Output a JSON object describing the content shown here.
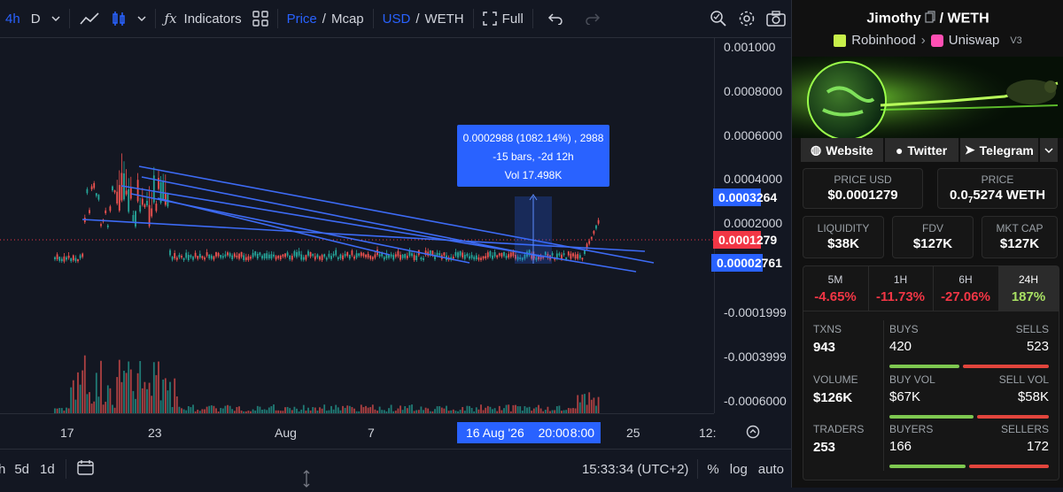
{
  "toolbar": {
    "interval": "4h",
    "day": "D",
    "indicators": "Indicators",
    "price": "Price",
    "mcap": "Mcap",
    "usd": "USD",
    "weth": "WETH",
    "full": "Full"
  },
  "price_axis": {
    "ticks": [
      "0.001000",
      "0.0008000",
      "0.0006000",
      "0.0004000",
      "0.0002000",
      "-0.0001999",
      "-0.0003999",
      "-0.0006000"
    ],
    "label_high": "0.0003264",
    "label_current": "0.0001279",
    "label_low": "0.00002761"
  },
  "time_axis": {
    "ticks": [
      "17",
      "23",
      "Aug",
      "7",
      "25",
      "12:"
    ],
    "crosshair_date": "16 Aug '26",
    "crosshair_time": "20:00",
    "crosshair_end": "08:00"
  },
  "measure_tooltip": {
    "line1": "0.0002988 (1082.14%) , 2988",
    "line2": "-15 bars, -2d 12h",
    "line3": "Vol 17.498K"
  },
  "bottom": {
    "ranges": [
      "h",
      "5d",
      "1d"
    ],
    "clock": "15:33:34 (UTC+2)",
    "percent": "%",
    "log": "log",
    "auto": "auto"
  },
  "panel": {
    "name": "Jimothy",
    "quote": "/ WETH",
    "chain": "Robinhood",
    "dex": "Uniswap",
    "version": "V3",
    "links": [
      "Website",
      "Twitter",
      "Telegram"
    ],
    "price_usd_label": "PRICE USD",
    "price_usd": "$0.0001279",
    "price_label": "PRICE",
    "price_weth_a": "0.0",
    "price_weth_sub": "7",
    "price_weth_b": "5274 WETH",
    "liquidity_label": "LIQUIDITY",
    "liquidity": "$38K",
    "fdv_label": "FDV",
    "fdv": "$127K",
    "mcap_label": "MKT CAP",
    "mcap": "$127K",
    "timeframes": [
      {
        "label": "5M",
        "value": "-4.65%"
      },
      {
        "label": "1H",
        "value": "-11.73%"
      },
      {
        "label": "6H",
        "value": "-27.06%"
      },
      {
        "label": "24H",
        "value": "187%"
      }
    ],
    "txns_label": "TXNS",
    "txns": "943",
    "buys_label": "BUYS",
    "buys": "420",
    "sells_label": "SELLS",
    "sells": "523",
    "volume_label": "VOLUME",
    "volume": "$126K",
    "buyvol_label": "BUY VOL",
    "buyvol": "$67K",
    "sellvol_label": "SELL VOL",
    "sellvol": "$58K",
    "traders_label": "TRADERS",
    "traders": "253",
    "buyers_label": "BUYERS",
    "buyers": "166",
    "sellers_label": "SELLERS",
    "sellers": "172",
    "buy_share_txns": 0.45,
    "buy_share_vol": 0.54,
    "buy_share_traders": 0.49
  }
}
